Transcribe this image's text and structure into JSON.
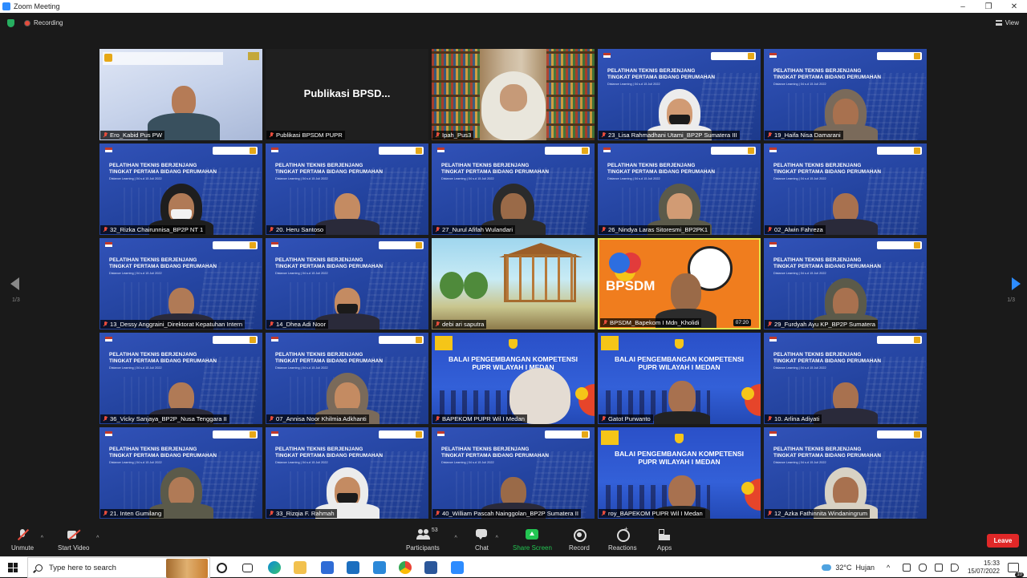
{
  "window": {
    "title": "Zoom Meeting",
    "minimize": "–",
    "restore": "❐",
    "close": "✕"
  },
  "topbar": {
    "recording_label": "Recording",
    "view_label": "View"
  },
  "pagination": {
    "left": "1/3",
    "right": "1/3"
  },
  "slide": {
    "title_line1": "PELATIHAN TEKNIS BERJENJANG",
    "title_line2": "TINGKAT PERTAMA BIDANG PERUMAHAN",
    "subtitle": "Distance Learning | 04 s.d 15 Juli 2022",
    "balai_line1": "BALAI PENGEMBANGAN KOMPETENSI",
    "balai_line2": "PUPR WILAYAH I MEDAN"
  },
  "tiles": [
    {
      "name": "Ero_Kabid Pus PW",
      "kind": "kabid"
    },
    {
      "name": "Publikasi BPSDM PUPR",
      "kind": "pub",
      "display": "Publikasi  BPSD..."
    },
    {
      "name": "Ipah_Pus3",
      "kind": "lib"
    },
    {
      "name": "23_Lisa Rahmadhani Utami_BP2P Sumatera III",
      "kind": "slide"
    },
    {
      "name": "19_Haifa Nisa Damarani",
      "kind": "slide"
    },
    {
      "name": "32_Rizka Chairunnisa_BP2P NT 1",
      "kind": "slide"
    },
    {
      "name": "20. Heru Santoso",
      "kind": "slide"
    },
    {
      "name": "27_Nurul Afifah Wulandari",
      "kind": "slide"
    },
    {
      "name": "26_Nindya Laras Sitoresmi_BP2PK1",
      "kind": "slide"
    },
    {
      "name": "02_Alwin Fahreza",
      "kind": "slide"
    },
    {
      "name": "13_Dessy Anggraini_Direktorat Kepatuhan Intern",
      "kind": "slide"
    },
    {
      "name": "14_Dhea Adi Noor",
      "kind": "slide"
    },
    {
      "name": "debi ari saputra",
      "kind": "cartoon"
    },
    {
      "name": "BPSDM_Bapekom I Mdn_Kholidi",
      "kind": "orange",
      "timer": "07:20",
      "brand": "BPSDM"
    },
    {
      "name": "29_Furdyah Ayu KP_BP2P Sumatera",
      "kind": "slide"
    },
    {
      "name": "36_Vicky Sanjaya_BP2P_Nusa Tenggara II",
      "kind": "slide"
    },
    {
      "name": "07_Annisa Noor Khilmia Adkhanti",
      "kind": "slide"
    },
    {
      "name": "BAPEKOM PUPR Wil I Medan",
      "kind": "balai"
    },
    {
      "name": "Gatot Purwanto",
      "kind": "balai"
    },
    {
      "name": "10. Arlina Adiyati",
      "kind": "slide"
    },
    {
      "name": "21. Inten Gumilang",
      "kind": "slide"
    },
    {
      "name": "33_Rizqia F. Rahmah",
      "kind": "slide"
    },
    {
      "name": "40_William Pascah Nainggolan_BP2P Sumatera II",
      "kind": "slide"
    },
    {
      "name": "roy_BAPEKOM PUPR Wil I Medan",
      "kind": "balai"
    },
    {
      "name": "12_Azka Fathinnita Windaningrum",
      "kind": "slide"
    }
  ],
  "toolbar": {
    "unmute": "Unmute",
    "start_video": "Start Video",
    "participants": "Participants",
    "participant_count": "53",
    "chat": "Chat",
    "share_screen": "Share Screen",
    "record": "Record",
    "reactions": "Reactions",
    "apps": "Apps",
    "leave": "Leave"
  },
  "taskbar": {
    "search_placeholder": "Type here to search",
    "weather_temp": "32°C",
    "weather_desc": "Hujan",
    "time": "15:33",
    "date": "15/07/2022",
    "notif_count": "10"
  },
  "colors": {
    "accent": "#2d8cff",
    "leave": "#e02828",
    "share": "#23c552",
    "active_speaker": "#e0e34a"
  }
}
